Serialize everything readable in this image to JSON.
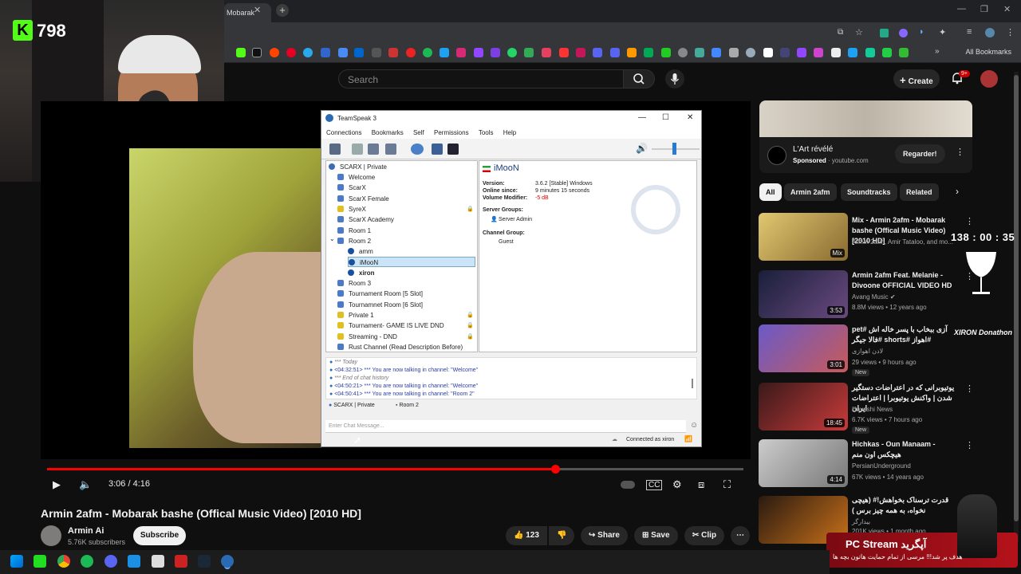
{
  "browser": {
    "tab_title": "Mobarak",
    "new_tab": "+",
    "bookmarks_all": "All Bookmarks"
  },
  "youtube_header": {
    "search_placeholder": "Search",
    "create_label": "Create",
    "notif_count": "9+"
  },
  "webcam": {
    "viewer_count": "798",
    "logo_letter": "K"
  },
  "player": {
    "time_current": "3:06",
    "time_total": "4:16",
    "time_display": "3:06 / 4:16",
    "progress_fraction": 0.73
  },
  "teamspeak": {
    "window_title": "TeamSpeak 3",
    "menu": [
      "Connections",
      "Bookmarks",
      "Self",
      "Permissions",
      "Tools",
      "Help"
    ],
    "server_name": "SCARX | Private",
    "channels": [
      {
        "label": "Welcome",
        "type": "channel"
      },
      {
        "label": "ScarX",
        "type": "channel"
      },
      {
        "label": "ScarX Female",
        "type": "channel"
      },
      {
        "label": "SyreX",
        "type": "locked"
      },
      {
        "label": "ScarX Academy",
        "type": "channel"
      },
      {
        "label": "Room 1",
        "type": "channel"
      },
      {
        "label": "Room 2",
        "type": "channel-open"
      },
      {
        "label": "amm",
        "type": "user"
      },
      {
        "label": "iMooN",
        "type": "user-selected"
      },
      {
        "label": "xiron",
        "type": "user"
      },
      {
        "label": "Room 3",
        "type": "channel"
      },
      {
        "label": "Tournament Room [5 Slot]",
        "type": "channel"
      },
      {
        "label": "Tournamnet Room [6 Slot]",
        "type": "channel"
      },
      {
        "label": "Private 1",
        "type": "locked"
      },
      {
        "label": "Tournament- GAME IS LIVE DND",
        "type": "locked"
      },
      {
        "label": "Streaming - DND",
        "type": "locked"
      },
      {
        "label": "Rust Channel (Read Description Before)",
        "type": "channel"
      }
    ],
    "info": {
      "nickname": "iMooN",
      "version_label": "Version:",
      "version_value": "3.6.2 [Stable] Windows",
      "online_label": "Online since:",
      "online_value": "9 minutes 15 seconds",
      "volume_label": "Volume Modifier:",
      "volume_value": "-5 dB",
      "server_groups_label": "Server Groups:",
      "server_group": "Server Admin",
      "channel_group_label": "Channel Group:",
      "channel_group": "Guest"
    },
    "log": [
      "*** Today",
      "<04:32:51> *** You are now talking in channel: \"Welcome\"",
      "*** End of chat history",
      "<04:50:21> *** You are now talking in channel: \"Welcome\"",
      "<04:50:41> *** You are now talking in channel: \"Room 2\""
    ],
    "chat_tabs": [
      "SCARX | Private",
      "Room 2"
    ],
    "chat_placeholder": "Enter Chat Message...",
    "status": "Connected as xiron"
  },
  "video": {
    "title": "Armin 2afm - Mobarak bashe (Offical Music Video) [2010 HD]",
    "channel": "Armin Ai",
    "subscribers": "5.76K subscribers",
    "subscribe_label": "Subscribe",
    "likes": "123",
    "share_label": "Share",
    "save_label": "Save",
    "clip_label": "Clip"
  },
  "sidebar": {
    "ad": {
      "title": "L'Art révélé",
      "sponsored": "Sponsored",
      "domain": "youtube.com",
      "cta": "Regarder!"
    },
    "chips": [
      "All",
      "Armin 2afm",
      "Soundtracks",
      "Related"
    ],
    "videos": [
      {
        "title": "Mix - Armin 2afm - Mobarak bashe (Offical Music Video) [2010 HD]",
        "meta1": "Armin 2afm, Amir Tataloo, and mo...",
        "meta2": "",
        "badge": "Mix",
        "new": ""
      },
      {
        "title": "Armin 2afm Feat. Melanie - Divoone OFFICIAL VIDEO HD",
        "meta1": "Avang Music",
        "meta2": "8.8M views • 12 years ago",
        "badge": "3:53",
        "new": ""
      },
      {
        "title": "pet# آزی ببخاب با پسر خاله اش فالا جیگر# shorts# اهواز#",
        "meta1": "لادن اهوازی",
        "meta2": "29 views • 9 hours ago",
        "badge": "3:01",
        "new": "New"
      },
      {
        "title": "یوتیوبرانی که در اعتراضات دستگیر شدن | واکنش یوتیوبرا | اعتراضات ایران",
        "meta1": "Havashi News",
        "meta2": "6.7K views • 7 hours ago",
        "badge": "18:45",
        "new": "New"
      },
      {
        "title": "Hichkas - Oun Manaam - هیچکس اون منم",
        "meta1": "PersianUnderground",
        "meta2": "67K views • 14 years ago",
        "badge": "4:14",
        "new": ""
      },
      {
        "title": "قدرت ترسناک بخواهش!# (هیچی نخواه، به همه چیز برس )",
        "meta1": "بیدارگر",
        "meta2": "201K views • 1 month ago",
        "badge": "",
        "new": ""
      }
    ]
  },
  "overlays": {
    "timer": "138 : 00 : 35",
    "donathon": "XIRON Donathon",
    "pc_title": "PC Stream آپگرید",
    "pc_sub": "هدف پر شد!!! مرسی از تمام حمایت هاتون بچه ها"
  },
  "colors": {
    "kick_green": "#53fc18",
    "youtube_red": "#ff0000",
    "ts_selected": "#cce4f7"
  }
}
